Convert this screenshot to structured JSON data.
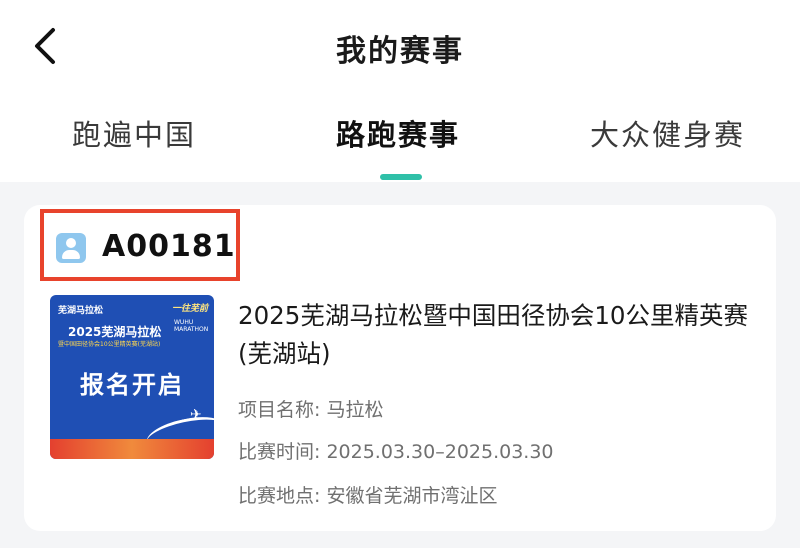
{
  "header": {
    "title": "我的赛事",
    "back_icon": "chevron-left-icon"
  },
  "tabs": [
    {
      "label": "跑遍中国",
      "active": false
    },
    {
      "label": "路跑赛事",
      "active": true
    },
    {
      "label": "大众健身赛",
      "active": false
    }
  ],
  "colors": {
    "accent": "#2fc0a8",
    "highlight_border": "#e8432c",
    "poster_blue": "#1f4fb4"
  },
  "event": {
    "bib_icon": "user-card-icon",
    "bib_number": "A00181",
    "poster": {
      "top_text": "芜湖马拉松",
      "brand_text": "一往芜前",
      "title": "2025芜湖马拉松",
      "title_en": "WUHU MARATHON",
      "subtitle": "暨中国田径协会10公里精英赛(芜湖站)",
      "main_text": "报名开启"
    },
    "title": "2025芜湖马拉松暨中国田径协会10公里精英赛(芜湖站)",
    "project": "项目名称: 马拉松",
    "time": "比赛时间: 2025.03.30–2025.03.30",
    "location": "比赛地点: 安徽省芜湖市湾沚区"
  }
}
